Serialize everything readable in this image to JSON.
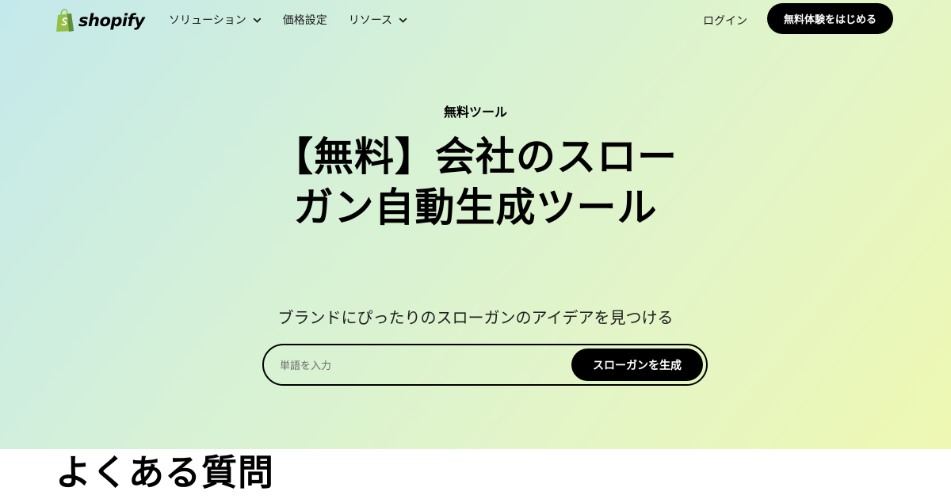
{
  "header": {
    "logo_text": "shopify",
    "nav": [
      {
        "label": "ソリューション",
        "icon": "chevron-down-icon"
      },
      {
        "label": "価格設定"
      },
      {
        "label": "リソース",
        "icon": "chevron-down-icon"
      }
    ],
    "login_label": "ログイン",
    "cta_label": "無料体験をはじめる"
  },
  "hero": {
    "eyebrow": "無料ツール",
    "title": "【無料】会社のスローガン自動生成ツール",
    "subtitle": "ブランドにぴったりのスローガンのアイデアを見つける",
    "search": {
      "placeholder": "単語を入力",
      "value": "",
      "button_label": "スローガンを生成"
    }
  },
  "faq": {
    "heading": "よくある質問"
  },
  "colors": {
    "brand_green": "#95bf47",
    "brand_dark_green": "#5e8e3e",
    "button_bg": "#000000",
    "hero_gradient": [
      "#c4e9ec",
      "#d6f1d6",
      "#e4f5c6",
      "#eef8b2"
    ]
  }
}
